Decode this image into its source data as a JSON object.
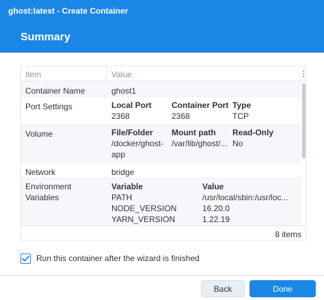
{
  "window": {
    "title": "ghost:latest - Create Container"
  },
  "header": {
    "title": "Summary"
  },
  "grid": {
    "columns": [
      "Item",
      "Value"
    ],
    "menu_icon": "more-vertical-icon",
    "rows": {
      "container_name": {
        "label": "Container Name",
        "value": "ghost1"
      },
      "port_settings": {
        "label": "Port Settings",
        "headers": [
          "Local Port",
          "Container Port",
          "Type"
        ],
        "values": [
          "2368",
          "2368",
          "TCP"
        ]
      },
      "volume": {
        "label": "Volume",
        "headers": [
          "File/Folder",
          "Mount path",
          "Read-Only"
        ],
        "file_folder_line1": "/docker/ghost-",
        "file_folder_line2": "app",
        "mount_path": "/var/lib/ghost/...",
        "read_only": "No"
      },
      "network": {
        "label": "Network",
        "value": "bridge"
      },
      "environment": {
        "label_line1": "Environment",
        "label_line2": "Variables",
        "headers": [
          "Variable",
          "Value"
        ],
        "vars": [
          {
            "name": "PATH",
            "value": "/usr/local/sbin:/usr/loc..."
          },
          {
            "name": "NODE_VERSION",
            "value": "16.20.0"
          },
          {
            "name": "YARN_VERSION",
            "value": "1.22.19"
          }
        ]
      }
    },
    "footer_count": "8 items"
  },
  "checkbox": {
    "label": "Run this container after the wizard is finished",
    "checked": true
  },
  "buttons": {
    "back": "Back",
    "done": "Done"
  },
  "colors": {
    "accent": "#1a87e6"
  }
}
